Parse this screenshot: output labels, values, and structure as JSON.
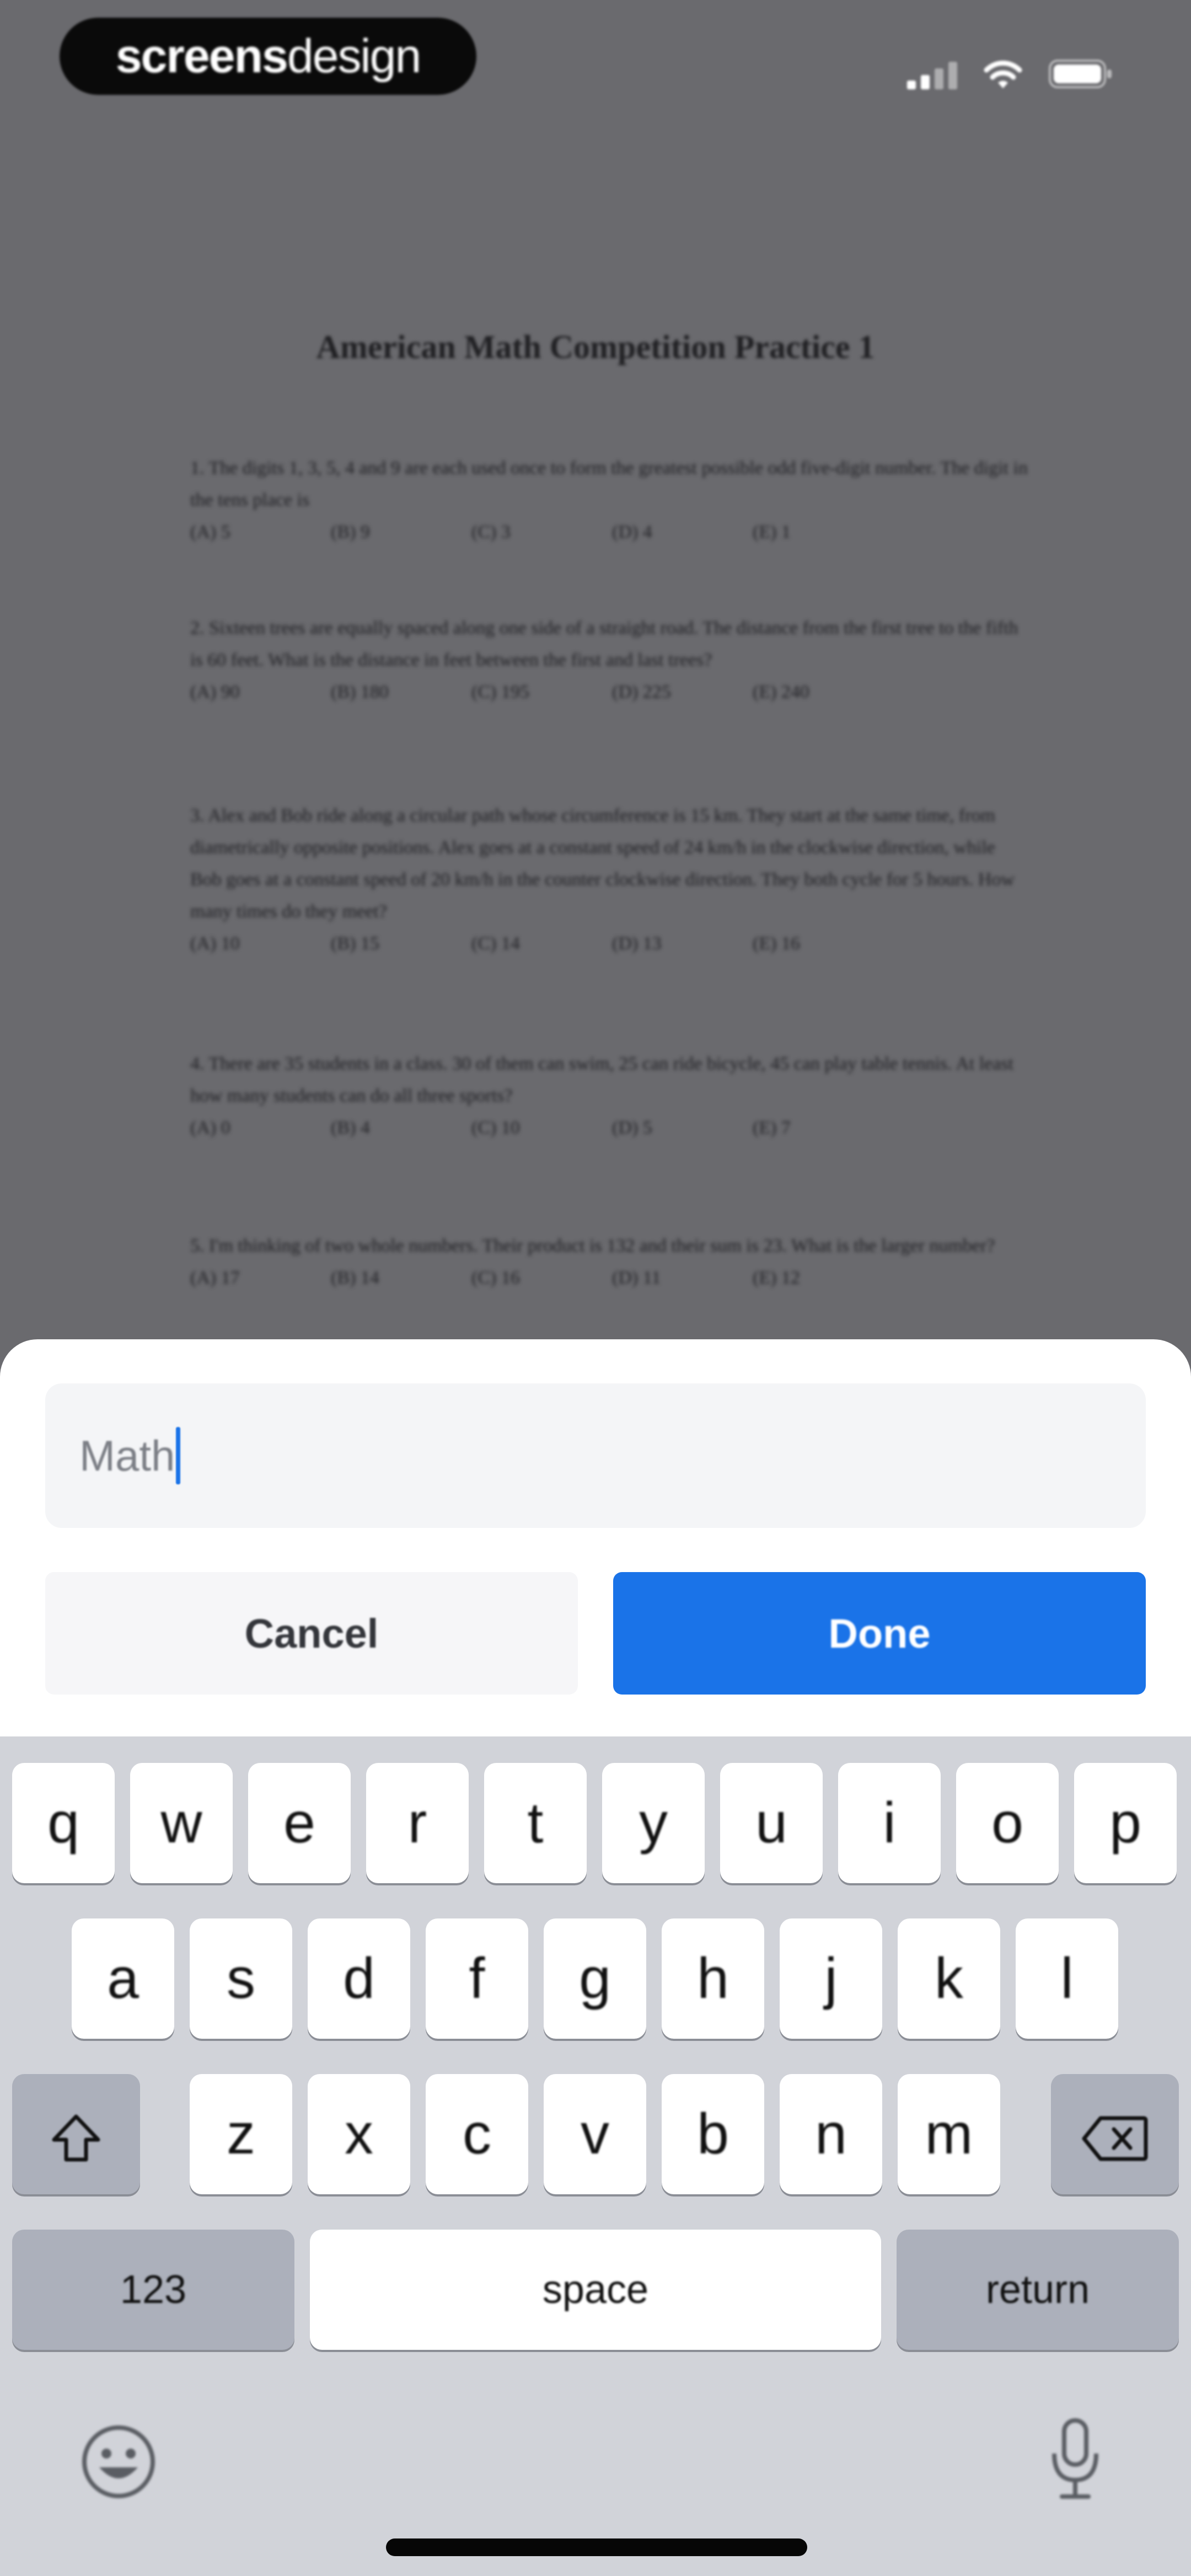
{
  "status_bar": {
    "brand_bold": "screens",
    "brand_light": "design"
  },
  "document": {
    "title": "American Math Competition Practice 1",
    "questions": [
      {
        "text": "1. The digits 1, 3, 5, 4 and 9 are each used once to form the greatest possible odd five-digit number. The digit in the tens place is",
        "choices": [
          "(A) 5",
          "(B) 9",
          "(C) 3",
          "(D) 4",
          "(E) 1"
        ]
      },
      {
        "text": "2. Sixteen trees are equally spaced along one side of a straight road. The distance from the first tree to the fifth is 60 feet. What is the distance in feet between the first and last trees?",
        "choices": [
          "(A) 90",
          "(B) 180",
          "(C) 195",
          "(D) 225",
          "(E) 240"
        ]
      },
      {
        "text": "3. Alex and Bob ride along a circular path whose circumference is 15 km. They start at the same time, from diametrically opposite positions. Alex goes at a constant speed of 24 km/h in the clockwise direction, while Bob goes at a constant speed of 20 km/h in the counter clockwise direction. They both cycle for 5 hours. How many times do they meet?",
        "choices": [
          "(A) 10",
          "(B) 15",
          "(C) 14",
          "(D) 13",
          "(E) 16"
        ]
      },
      {
        "text": "4. There are 35 students in a class. 30 of them can swim, 25 can ride bicycle, 45 can play table tennis. At least how many students can do all three sports?",
        "choices": [
          "(A) 0",
          "(B) 4",
          "(C) 10",
          "(D) 5",
          "(E) 7"
        ]
      },
      {
        "text": "5. I'm thinking of two whole numbers. Their product is 132 and their sum is 23. What is the larger number?",
        "choices": [
          "(A) 17",
          "(B) 14",
          "(C) 16",
          "(D) 11",
          "(E) 12"
        ]
      }
    ]
  },
  "sheet": {
    "input_value": "Math",
    "cancel_label": "Cancel",
    "done_label": "Done"
  },
  "keyboard": {
    "row1": [
      "q",
      "w",
      "e",
      "r",
      "t",
      "y",
      "u",
      "i",
      "o",
      "p"
    ],
    "row2": [
      "a",
      "s",
      "d",
      "f",
      "g",
      "h",
      "j",
      "k",
      "l"
    ],
    "row3": [
      "z",
      "x",
      "c",
      "v",
      "b",
      "n",
      "m"
    ],
    "numbers_label": "123",
    "space_label": "space",
    "return_label": "return",
    "shift_icon": "shift-icon",
    "delete_icon": "delete-icon",
    "emoji_icon": "emoji-icon",
    "mic_icon": "microphone-icon"
  },
  "colors": {
    "accent": "#1a73e8",
    "keyboard_bg": "#d1d3d9",
    "special_key": "#acb0bb"
  }
}
